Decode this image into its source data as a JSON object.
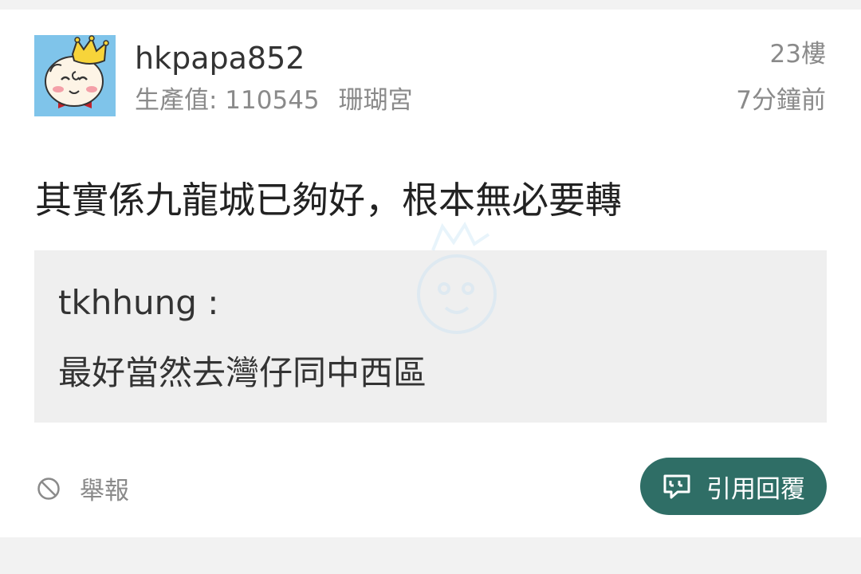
{
  "post": {
    "username": "hkpapa852",
    "production_label": "生產值: 110545",
    "group": "珊瑚宮",
    "floor": "23樓",
    "time": "7分鐘前",
    "content": "其實係九龍城已夠好，根本無必要轉"
  },
  "quote": {
    "author": "tkhhung :",
    "text": "最好當然去灣仔同中西區"
  },
  "actions": {
    "report_label": "舉報",
    "reply_label": "引用回覆"
  },
  "colors": {
    "accent": "#2f6e66",
    "avatar_bg": "#7fc4ea",
    "quote_bg": "#efefef"
  },
  "icons": {
    "report": "block-icon",
    "reply": "quote-reply-icon",
    "avatar": "baby-king-avatar"
  }
}
